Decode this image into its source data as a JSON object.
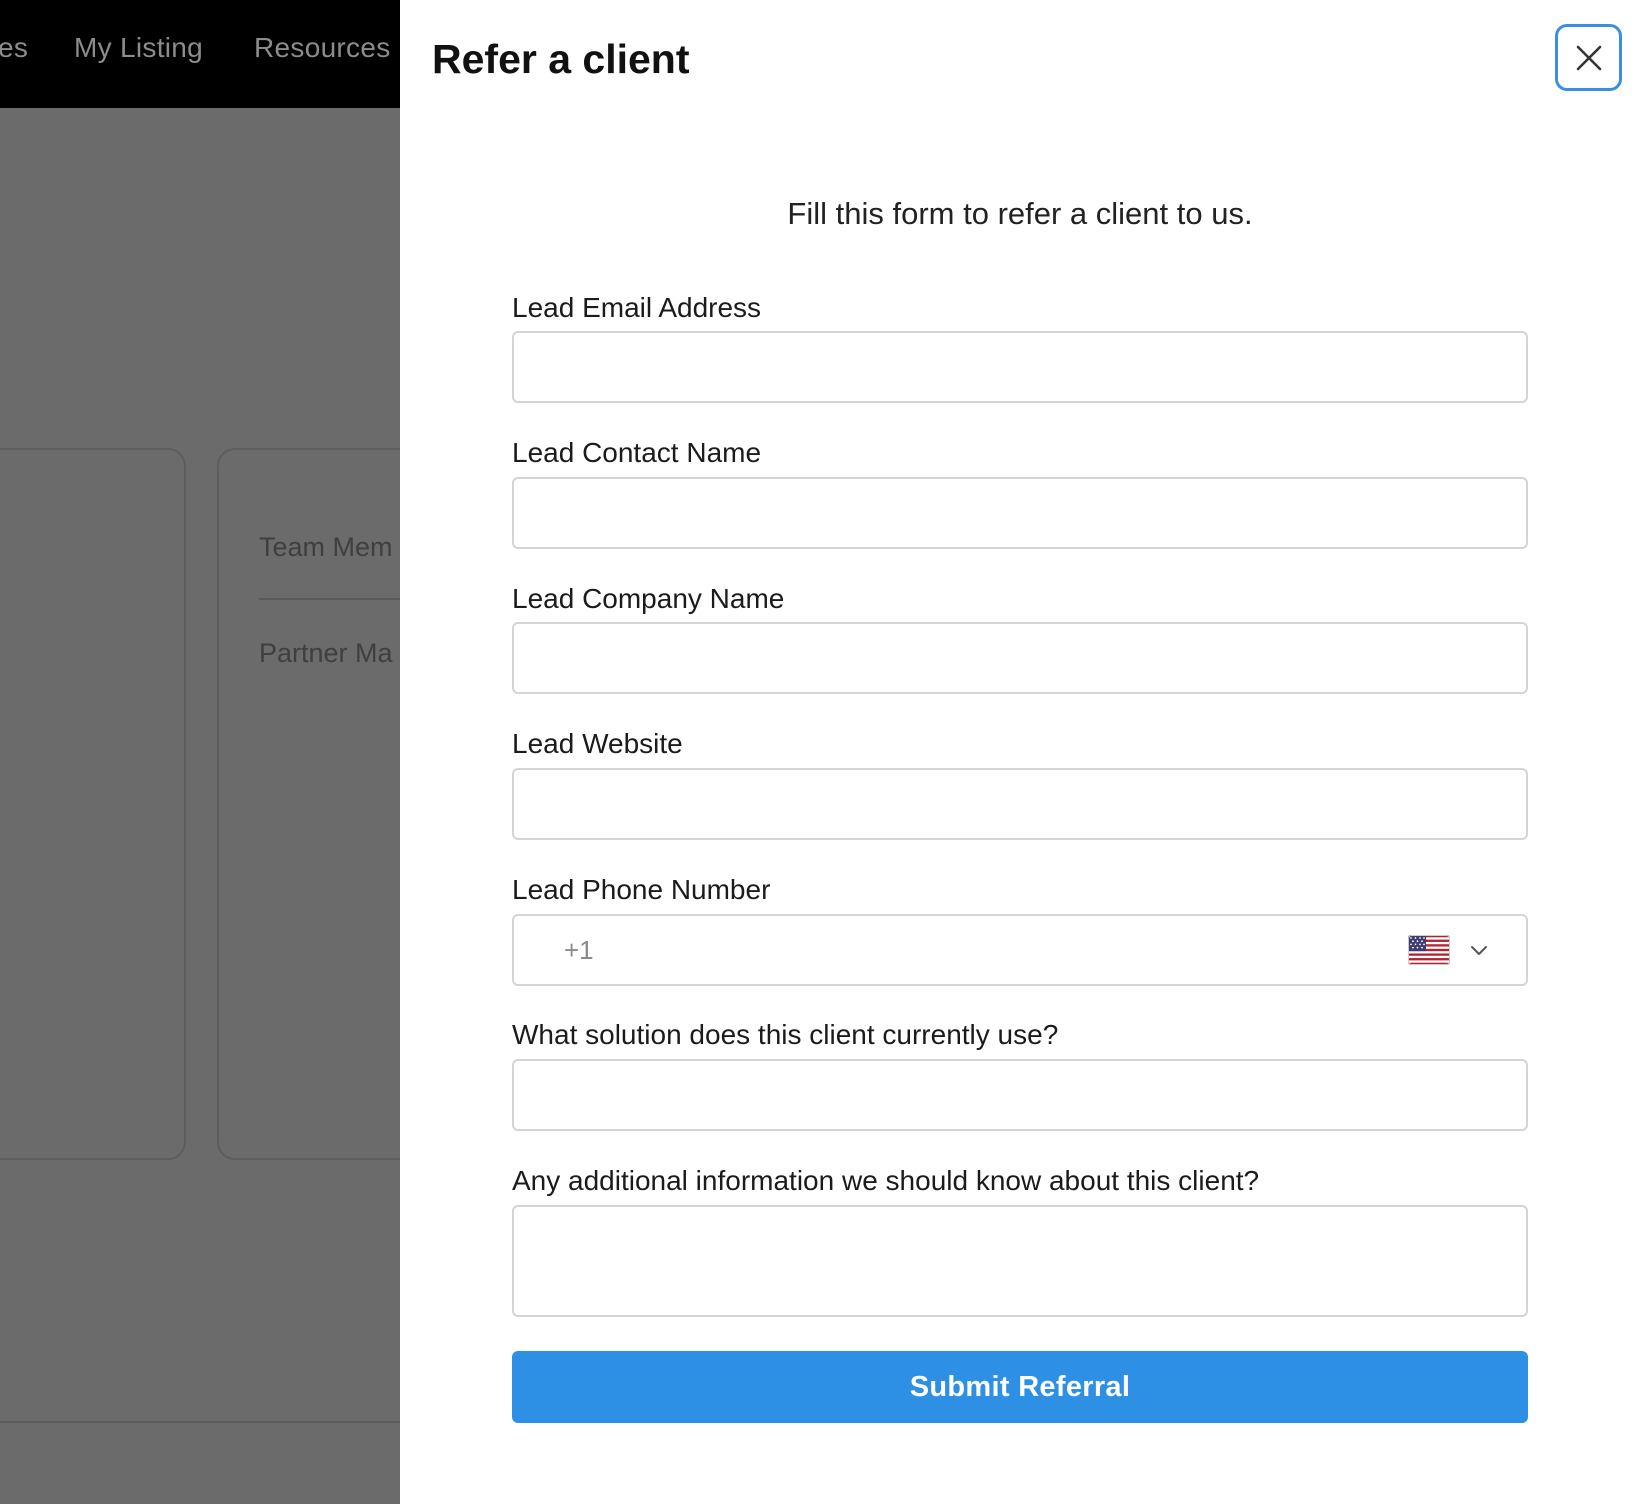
{
  "background": {
    "nav_items": [
      {
        "label": "es"
      },
      {
        "label": "My Listing"
      },
      {
        "label": "Resources"
      }
    ],
    "card_rows": [
      {
        "label": "Team Mem"
      },
      {
        "label": "Partner Ma"
      }
    ]
  },
  "drawer": {
    "title": "Refer a client",
    "close_icon": "close-icon",
    "subtitle": "Fill this form to refer a client to us.",
    "fields": {
      "email": {
        "label": "Lead Email Address",
        "value": ""
      },
      "contact_name": {
        "label": "Lead Contact Name",
        "value": ""
      },
      "company_name": {
        "label": "Lead Company Name",
        "value": ""
      },
      "website": {
        "label": "Lead Website",
        "value": ""
      },
      "phone": {
        "label": "Lead Phone Number",
        "placeholder": "+1",
        "country_flag": "us-flag-icon"
      },
      "current_solution": {
        "label": "What solution does this client currently use?",
        "value": ""
      },
      "additional_info": {
        "label": "Any additional information we should know about this client?",
        "value": ""
      }
    },
    "submit_label": "Submit Referral"
  },
  "colors": {
    "accent": "#2e90e5",
    "overlay": "#6b6b6b",
    "nav_bg": "#000000"
  }
}
